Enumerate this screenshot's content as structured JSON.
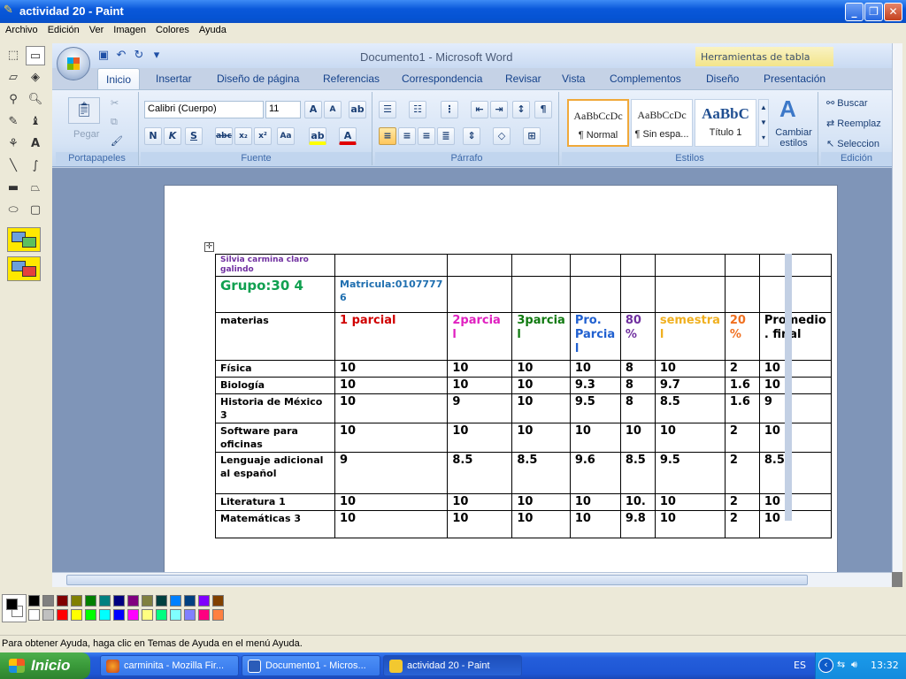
{
  "paint": {
    "title": "actividad 20 - Paint",
    "menu": [
      "Archivo",
      "Edición",
      "Ver",
      "Imagen",
      "Colores",
      "Ayuda"
    ],
    "status": "Para obtener Ayuda, haga clic en Temas de Ayuda en el menú Ayuda.",
    "palette_top": [
      "#000000",
      "#808080",
      "#800000",
      "#808000",
      "#008000",
      "#008080",
      "#000080",
      "#800080",
      "#808040",
      "#004040",
      "#0080FF",
      "#004080",
      "#8000FF",
      "#804000"
    ],
    "palette_bottom": [
      "#FFFFFF",
      "#C0C0C0",
      "#FF0000",
      "#FFFF00",
      "#00FF00",
      "#00FFFF",
      "#0000FF",
      "#FF00FF",
      "#FFFF80",
      "#00FF80",
      "#80FFFF",
      "#8080FF",
      "#FF0080",
      "#FF8040"
    ]
  },
  "word": {
    "title": "Documento1 - Microsoft Word",
    "context_tab": "Herramientas de tabla",
    "tabs": [
      "Inicio",
      "Insertar",
      "Diseño de página",
      "Referencias",
      "Correspondencia",
      "Revisar",
      "Vista",
      "Complementos",
      "Diseño",
      "Presentación"
    ],
    "groups": {
      "portapapeles": "Portapapeles",
      "fuente": "Fuente",
      "parrafo": "Párrafo",
      "estilos": "Estilos",
      "edicion": "Edición"
    },
    "pegar": "Pegar",
    "font_name": "Calibri (Cuerpo)",
    "font_size": "11",
    "styles": [
      {
        "sample": "AaBbCcDc",
        "name": "¶ Normal"
      },
      {
        "sample": "AaBbCcDc",
        "name": "¶ Sin espa..."
      },
      {
        "sample": "AaBbC",
        "name": "Título 1"
      }
    ],
    "change_styles": "Cambiar estilos",
    "find": "Buscar",
    "replace": "Reemplaz",
    "select": "Seleccion"
  },
  "table": {
    "student": "Silvia carmina claro galindo",
    "group": "Grupo:30 4",
    "matricula": "Matricula:0107777 6",
    "headers": [
      {
        "text": "materias",
        "color": "#000000"
      },
      {
        "text": "1 parcial",
        "color": "#D00000"
      },
      {
        "text": "2parcia l",
        "color": "#E020C0"
      },
      {
        "text": "3parcia l",
        "color": "#107A10"
      },
      {
        "text": "Pro. Parcia l",
        "color": "#2060D0"
      },
      {
        "text": "80 %",
        "color": "#7030A0"
      },
      {
        "text": "semestra l",
        "color": "#F0B020"
      },
      {
        "text": "20 %",
        "color": "#F07020"
      },
      {
        "text": "Promedio . final",
        "color": "#000000"
      }
    ],
    "rows": [
      [
        "Física",
        "10",
        "10",
        "10",
        "10",
        "8",
        "10",
        "2",
        "10"
      ],
      [
        "Biología",
        "10",
        "10",
        "10",
        "9.3",
        "8",
        "9.7",
        "1.6",
        "10"
      ],
      [
        "Historia de México 3",
        "10",
        "9",
        "10",
        "9.5",
        "8",
        "8.5",
        "1.6",
        "9"
      ],
      [
        "Software para oficinas",
        "10",
        "10",
        "10",
        "10",
        "10",
        "10",
        "2",
        "10"
      ],
      [
        "Lenguaje adicional al español",
        "9",
        "8.5",
        "8.5",
        "9.6",
        "8.5",
        "9.5",
        "2",
        "8.5"
      ],
      [
        "Literatura 1",
        "10",
        "10",
        "10",
        "10",
        "10.",
        "10",
        "2",
        "10"
      ],
      [
        "Matemáticas 3",
        "10",
        "10",
        "10",
        "10",
        "9.8",
        "10",
        "2",
        "10"
      ]
    ]
  },
  "taskbar": {
    "start": "Inicio",
    "tasks": [
      "carminita - Mozilla Fir...",
      "Documento1 - Micros...",
      "actividad 20 - Paint"
    ],
    "lang": "ES",
    "clock": "13:32"
  }
}
